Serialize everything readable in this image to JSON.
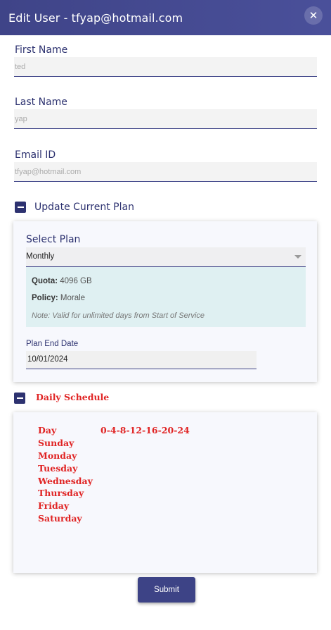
{
  "dialog": {
    "title": "Edit User - tfyap@hotmail.com",
    "close_icon": "close-icon"
  },
  "form": {
    "first_name": {
      "label": "First Name",
      "value": "ted"
    },
    "last_name": {
      "label": "Last Name",
      "value": "yap"
    },
    "email": {
      "label": "Email ID",
      "value": "tfyap@hotmail.com"
    }
  },
  "plan_section": {
    "toggle_icon": "minus-square-icon",
    "title": "Update Current Plan",
    "select_label": "Select Plan",
    "selected_plan": "Monthly",
    "quota_label": "Quota:",
    "quota_value": "4096 GB",
    "policy_label": "Policy:",
    "policy_value": "Morale",
    "note": "Note: Valid for unlimited days from Start of Service",
    "end_date_label": "Plan End Date",
    "end_date_value": "10/01/2024"
  },
  "schedule_section": {
    "toggle_icon": "minus-square-icon",
    "title": "Daily Schedule",
    "day_header": "Day",
    "hours_header": "0-4-8-12-16-20-24",
    "days": [
      "Sunday",
      "Monday",
      "Tuesday",
      "Wednesday",
      "Thursday",
      "Friday",
      "Saturday"
    ]
  },
  "submit_label": "Submit",
  "colors": {
    "header": "#3f4488",
    "accent": "#2d3270",
    "schedule_text": "#e02424",
    "info_bg": "#dff0f2"
  }
}
